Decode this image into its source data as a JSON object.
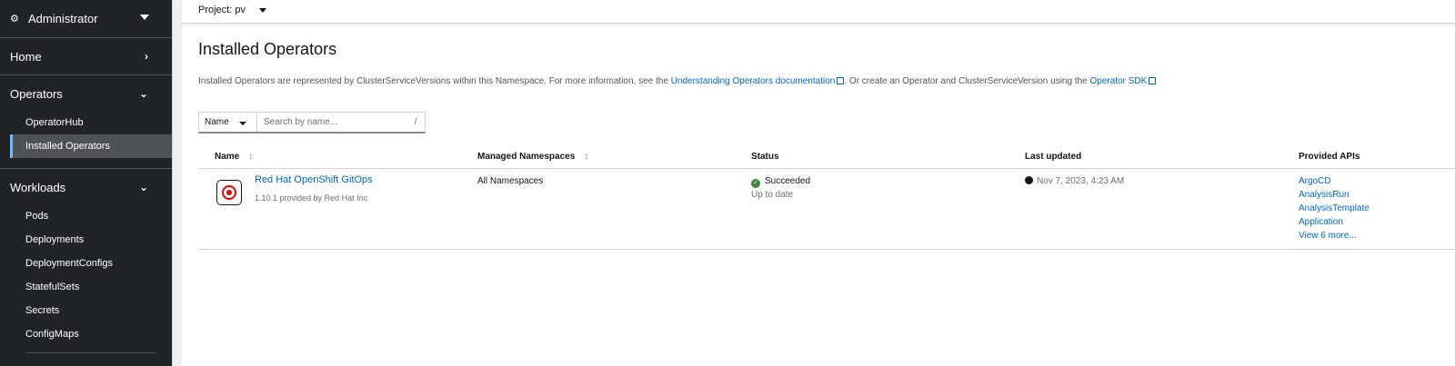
{
  "sidebar": {
    "perspective": "Administrator",
    "sections": [
      {
        "label": "Home"
      },
      {
        "label": "Operators",
        "items": [
          "OperatorHub",
          "Installed Operators"
        ]
      },
      {
        "label": "Workloads",
        "items": [
          "Pods",
          "Deployments",
          "DeploymentConfigs",
          "StatefulSets",
          "Secrets",
          "ConfigMaps"
        ]
      }
    ]
  },
  "topbar": {
    "project_label": "Project: pv"
  },
  "page": {
    "title": "Installed Operators",
    "description_1": "Installed Operators are represented by ClusterServiceVersions within this Namespace. For more information, see the",
    "link_1": "Understanding Operators documentation",
    "description_2": ". Or create an Operator and ClusterServiceVersion using the",
    "link_2": "Operator SDK"
  },
  "filter": {
    "type": "Name",
    "placeholder": "Search by name...",
    "shortcut": "/"
  },
  "table": {
    "columns": [
      "Name",
      "Managed Namespaces",
      "Status",
      "Last updated",
      "Provided APIs"
    ],
    "rows": [
      {
        "name": "Red Hat OpenShift GitOps",
        "version": "1.10.1 provided by Red Hat Inc",
        "namespaces": "All Namespaces",
        "status": "Succeeded",
        "status_detail": "Up to date",
        "updated": "Nov 7, 2023, 4:23 AM",
        "apis": [
          "ArgoCD",
          "AnalysisRun",
          "AnalysisTemplate",
          "Application"
        ],
        "more": "View 6 more..."
      }
    ]
  },
  "colors": {
    "sidebar_bg": "#212427",
    "link": "#0066cc",
    "success": "#3e8635",
    "active_accent": "#73bcf7"
  }
}
